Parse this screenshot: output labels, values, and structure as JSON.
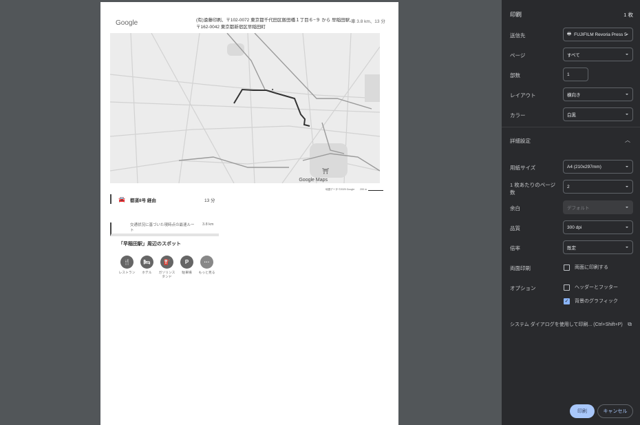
{
  "preview": {
    "logo": "Google",
    "header": "(有)遠藤印刷、〒102-0072 東京都千代田区飯田橋１丁目６−９ から 早稲田駅、〒162-0042 東京都新宿区早稲田町",
    "summary": "車 3.8 km、13 分",
    "map_label": "Google Maps",
    "attribution": "地図データ ©2025 Google",
    "scale": "200 m",
    "route": {
      "name": "都道8号 経由",
      "time": "13 分",
      "desc": "交通状況に基づいた現時点の最速ルート",
      "distance": "3.8 km"
    },
    "spots_title": "「早稲田駅」周辺のスポット",
    "spots": [
      {
        "icon": "restaurant-icon",
        "glyph": "🍴",
        "label": "レストラン"
      },
      {
        "icon": "hotel-icon",
        "glyph": "🛏",
        "label": "ホテル"
      },
      {
        "icon": "gas-station-icon",
        "glyph": "⛽",
        "label": "ガソリンスタンド"
      },
      {
        "icon": "parking-icon",
        "glyph": "P",
        "label": "駐車場"
      },
      {
        "icon": "more-icon",
        "glyph": "···",
        "label": "もっと見る"
      }
    ]
  },
  "panel": {
    "title": "印刷",
    "sheets": "1 枚",
    "destination": {
      "label": "送信先",
      "value": "FUJIFILM Revoria Press 5"
    },
    "pages": {
      "label": "ページ",
      "value": "すべて"
    },
    "copies": {
      "label": "部数",
      "value": "1"
    },
    "layout": {
      "label": "レイアウト",
      "value": "横向き"
    },
    "color": {
      "label": "カラー",
      "value": "白黒"
    },
    "more_settings": "詳細設定",
    "paper_size": {
      "label": "用紙サイズ",
      "value": "A4 (210x297mm)"
    },
    "pages_per_sheet": {
      "label": "1 枚あたりのページ数",
      "value": "2"
    },
    "margins": {
      "label": "余白",
      "value": "デフォルト"
    },
    "quality": {
      "label": "品質",
      "value": "300 dpi"
    },
    "scale": {
      "label": "倍率",
      "value": "既定"
    },
    "duplex": {
      "label": "両面印刷",
      "option": "両面に印刷する",
      "checked": false
    },
    "options": {
      "label": "オプション",
      "headers_footers": "ヘッダーとフッター",
      "headers_checked": false,
      "background": "背景のグラフィック",
      "background_checked": true
    },
    "system_dialog": "システム ダイアログを使用して印刷... (Ctrl+Shift+P)",
    "print_button": "印刷",
    "cancel_button": "キャンセル"
  }
}
